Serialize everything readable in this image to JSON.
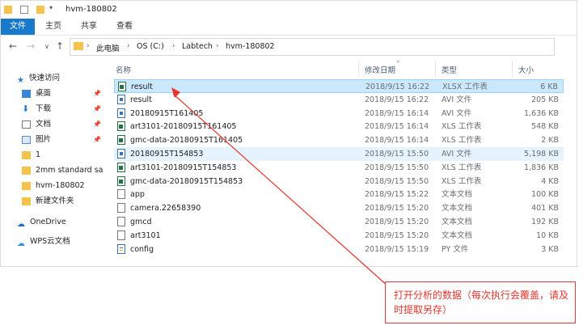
{
  "window": {
    "title": "hvm-180802"
  },
  "ribbon": {
    "tabs": [
      "文件",
      "主页",
      "共享",
      "查看"
    ]
  },
  "address": {
    "crumbs": [
      "此电脑",
      "OS (C:)",
      "Labtech",
      "hvm-180802"
    ]
  },
  "sidebar": {
    "items": [
      {
        "label": "快速访问",
        "icon": "star-icon"
      },
      {
        "label": "桌面",
        "icon": "desktop-icon",
        "pinned": true
      },
      {
        "label": "下载",
        "icon": "download-icon",
        "pinned": true
      },
      {
        "label": "文档",
        "icon": "document-icon",
        "pinned": true
      },
      {
        "label": "图片",
        "icon": "picture-icon",
        "pinned": true
      },
      {
        "label": "1",
        "icon": "folder-icon"
      },
      {
        "label": "2mm standard sa",
        "icon": "folder-icon"
      },
      {
        "label": "hvm-180802",
        "icon": "folder-icon"
      },
      {
        "label": "新建文件夹",
        "icon": "folder-icon"
      },
      {
        "label": "OneDrive",
        "icon": "cloud-icon"
      },
      {
        "label": "WPS云文档",
        "icon": "cloud-icon"
      }
    ]
  },
  "columns": {
    "name": "名称",
    "date": "修改日期",
    "type": "类型",
    "size": "大小"
  },
  "files": [
    {
      "name": "result",
      "date": "2018/9/15 16:22",
      "type": "XLSX 工作表",
      "size": "6 KB",
      "icon": "xls"
    },
    {
      "name": "result",
      "date": "2018/9/15 16:22",
      "type": "AVI 文件",
      "size": "205 KB",
      "icon": "avi"
    },
    {
      "name": "20180915T161405",
      "date": "2018/9/15 16:14",
      "type": "AVI 文件",
      "size": "1,636 KB",
      "icon": "avi"
    },
    {
      "name": "art3101-20180915T161405",
      "date": "2018/9/15 16:14",
      "type": "XLS 工作表",
      "size": "548 KB",
      "icon": "xls"
    },
    {
      "name": "gmc-data-20180915T161405",
      "date": "2018/9/15 16:14",
      "type": "XLS 工作表",
      "size": "2 KB",
      "icon": "xls"
    },
    {
      "name": "20180915T154853",
      "date": "2018/9/15 15:50",
      "type": "AVI 文件",
      "size": "5,198 KB",
      "icon": "avi"
    },
    {
      "name": "art3101-20180915T154853",
      "date": "2018/9/15 15:50",
      "type": "XLS 工作表",
      "size": "1,836 KB",
      "icon": "xls"
    },
    {
      "name": "gmc-data-20180915T154853",
      "date": "2018/9/15 15:50",
      "type": "XLS 工作表",
      "size": "4 KB",
      "icon": "xls"
    },
    {
      "name": "app",
      "date": "2018/9/15 15:22",
      "type": "文本文档",
      "size": "100 KB",
      "icon": "txt"
    },
    {
      "name": "camera.22658390",
      "date": "2018/9/15 15:20",
      "type": "文本文档",
      "size": "401 KB",
      "icon": "txt"
    },
    {
      "name": "gmcd",
      "date": "2018/9/15 15:20",
      "type": "文本文档",
      "size": "192 KB",
      "icon": "txt"
    },
    {
      "name": "art3101",
      "date": "2018/9/15 15:20",
      "type": "文本文档",
      "size": "10 KB",
      "icon": "txt"
    },
    {
      "name": "config",
      "date": "2018/9/15 15:19",
      "type": "PY 文件",
      "size": "3 KB",
      "icon": "py"
    }
  ],
  "annotation": {
    "text": "打开分析的数据（每次执行会覆盖，请及时提取另存）",
    "color": "#e8352c"
  }
}
